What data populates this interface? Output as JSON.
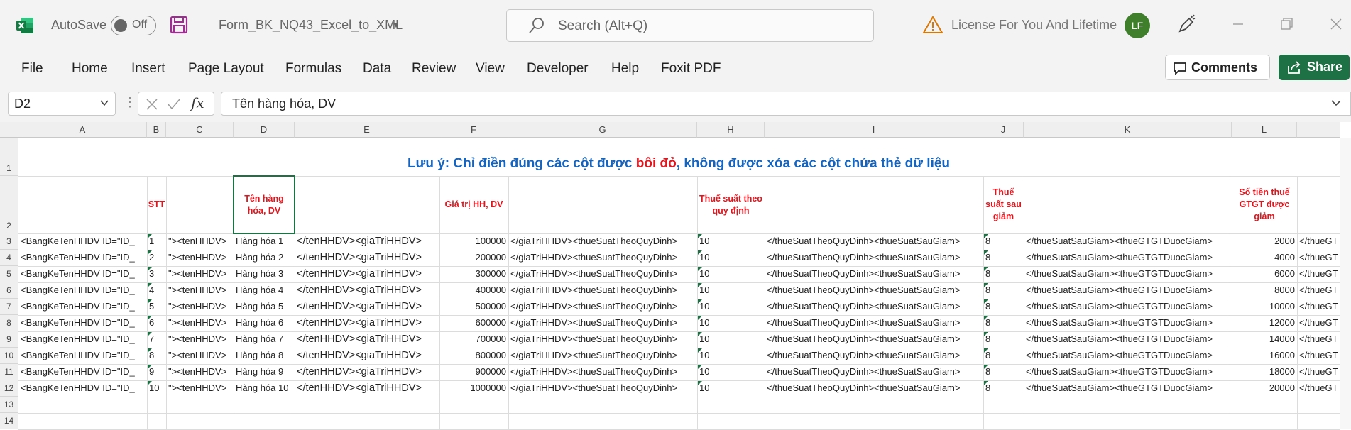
{
  "title_bar": {
    "autosave_label": "AutoSave",
    "autosave_state": "Off",
    "document_name": "Form_BK_NQ43_Excel_to_XML",
    "search_placeholder": "Search (Alt+Q)",
    "license_text": "License For You And Lifetime",
    "avatar_initials": "LF"
  },
  "ribbon": {
    "tabs": [
      "File",
      "Home",
      "Insert",
      "Page Layout",
      "Formulas",
      "Data",
      "Review",
      "View",
      "Developer",
      "Help",
      "Foxit PDF"
    ],
    "comments_label": "Comments",
    "share_label": "Share"
  },
  "formula_bar": {
    "name_box": "D2",
    "fx_label": "fx",
    "content": "Tên hàng hóa, DV"
  },
  "sheet": {
    "columns": [
      "A",
      "B",
      "C",
      "D",
      "E",
      "F",
      "G",
      "H",
      "I",
      "J",
      "K",
      "L"
    ],
    "row_numbers": [
      "1",
      "2",
      "3",
      "4",
      "5",
      "6",
      "7",
      "8",
      "9",
      "10",
      "11",
      "12",
      "13",
      "14"
    ],
    "note_prefix": "Lưu ý: Chỉ điền đúng các cột được ",
    "note_red": "bôi đỏ",
    "note_suffix": ", không được xóa các cột chứa thẻ dữ liệu",
    "headers": {
      "B": "STT",
      "D": "Tên hàng hóa, DV",
      "F": "Giá trị HH, DV",
      "H": "Thuế suất theo quy định",
      "J": "Thuế suất sau giảm",
      "L": "Số tiền thuế GTGT được giảm"
    },
    "fixed": {
      "A": "<BangKeTenHHDV ID=\"ID_",
      "C": "\"><tenHHDV>",
      "E": "</tenHHDV><giaTriHHDV>",
      "G": "</giaTriHHDV><thueSuatTheoQuyDinh>",
      "I": "</thueSuatTheoQuyDinh><thueSuatSauGiam>",
      "K": "</thueSuatSauGiam><thueGTGTDuocGiam>",
      "M": "</thueGT"
    },
    "rows": [
      {
        "stt": "1",
        "name": "Hàng hóa 1",
        "value": "100000",
        "rate": "10",
        "rate_after": "8",
        "reduced": "2000"
      },
      {
        "stt": "2",
        "name": "Hàng hóa 2",
        "value": "200000",
        "rate": "10",
        "rate_after": "8",
        "reduced": "4000"
      },
      {
        "stt": "3",
        "name": "Hàng hóa 3",
        "value": "300000",
        "rate": "10",
        "rate_after": "8",
        "reduced": "6000"
      },
      {
        "stt": "4",
        "name": "Hàng hóa 4",
        "value": "400000",
        "rate": "10",
        "rate_after": "8",
        "reduced": "8000"
      },
      {
        "stt": "5",
        "name": "Hàng hóa 5",
        "value": "500000",
        "rate": "10",
        "rate_after": "8",
        "reduced": "10000"
      },
      {
        "stt": "6",
        "name": "Hàng hóa 6",
        "value": "600000",
        "rate": "10",
        "rate_after": "8",
        "reduced": "12000"
      },
      {
        "stt": "7",
        "name": "Hàng hóa 7",
        "value": "700000",
        "rate": "10",
        "rate_after": "8",
        "reduced": "14000"
      },
      {
        "stt": "8",
        "name": "Hàng hóa 8",
        "value": "800000",
        "rate": "10",
        "rate_after": "8",
        "reduced": "16000"
      },
      {
        "stt": "9",
        "name": "Hàng hóa 9",
        "value": "900000",
        "rate": "10",
        "rate_after": "8",
        "reduced": "18000"
      },
      {
        "stt": "10",
        "name": "Hàng hóa 10",
        "value": "1000000",
        "rate": "10",
        "rate_after": "8",
        "reduced": "20000"
      }
    ]
  }
}
